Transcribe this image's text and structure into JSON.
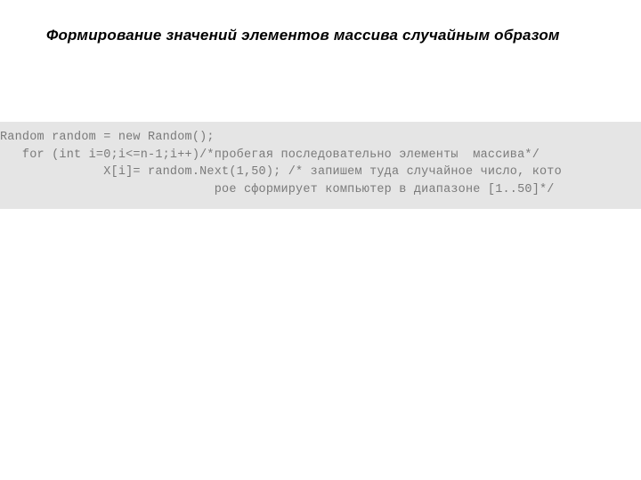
{
  "title": "Формирование значений элементов массива случайным образом",
  "code": {
    "line1": "Random random = new Random();",
    "line2": "",
    "line3": "   for (int i=0;i<=n-1;i++)/*пробегая последовательно элементы  массива*/",
    "line4": "              X[i]= random.Next(1,50); /* запишем туда случайное число, кото",
    "line5": "                             рое сформирует компьютер в диапазоне [1..50]*/"
  }
}
